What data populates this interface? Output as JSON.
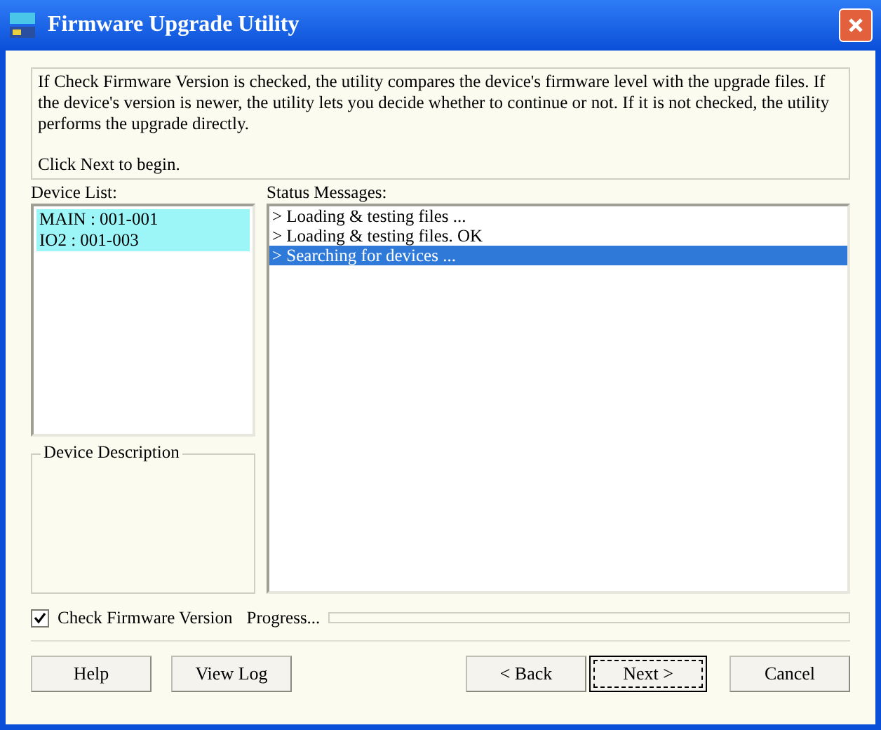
{
  "window": {
    "title": "Firmware Upgrade Utility"
  },
  "intro": {
    "text": "If Check Firmware Version is checked, the utility compares the device's firmware level with the upgrade files. If the device's version is newer, the utility lets you decide whether to continue or not. If it is not checked, the utility performs the upgrade directly.",
    "prompt": "Click Next to begin."
  },
  "device_list": {
    "label": "Device List:",
    "items": [
      {
        "text": "MAIN : 001-001",
        "selected": true
      },
      {
        "text": "IO2 : 001-003",
        "selected": true
      }
    ]
  },
  "device_description": {
    "label": "Device Description"
  },
  "status_messages": {
    "label": "Status Messages:",
    "items": [
      {
        "text": "> Loading & testing files ...",
        "selected": false
      },
      {
        "text": "> Loading & testing files. OK",
        "selected": false
      },
      {
        "text": "> Searching for devices ...",
        "selected": true
      }
    ]
  },
  "check_firmware": {
    "label": "Check Firmware Version",
    "checked": true
  },
  "progress": {
    "label": "Progress...",
    "level": 0
  },
  "buttons": [
    {
      "label": "Help",
      "focused": false
    },
    {
      "label": "View Log",
      "focused": false
    },
    {
      "label": "< Back",
      "focused": false
    },
    {
      "label": "Next >",
      "focused": true
    },
    {
      "label": "Cancel",
      "focused": false
    }
  ]
}
